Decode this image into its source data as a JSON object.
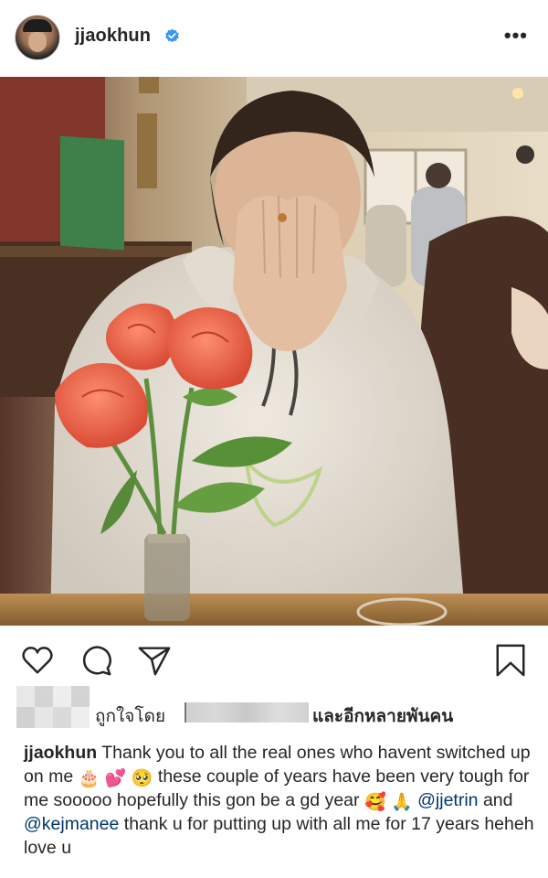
{
  "header": {
    "username": "jjaokhun",
    "verified_icon": "verified-badge-icon",
    "more_icon": "more-options-icon",
    "more_label": "•••",
    "accent_color": "#3897f0"
  },
  "photo": {
    "description_icon": "post-photo"
  },
  "actions": {
    "like_icon": "heart-icon",
    "comment_icon": "comment-icon",
    "share_icon": "share-icon",
    "save_icon": "bookmark-icon"
  },
  "likes": {
    "prefix": "ถูกใจโดย",
    "suffix": "และอีกหลายพันคน"
  },
  "caption": {
    "username": "jjaokhun",
    "part1": "Thank you to all the real ones who havent switched up on me",
    "emoji1": "🎂",
    "emoji2": "💕",
    "emoji3": "🥺",
    "part2": "these couple of years have been very tough for me sooooo hopefully this gon be a gd year",
    "emoji4": "🥰",
    "emoji5": "🙏",
    "mention1": "@jjetrin",
    "and": "and",
    "mention2": "@kejmanee",
    "part3": "thank u for putting up with all me for 17 years heheh love u",
    "mention_color": "#00376b"
  }
}
